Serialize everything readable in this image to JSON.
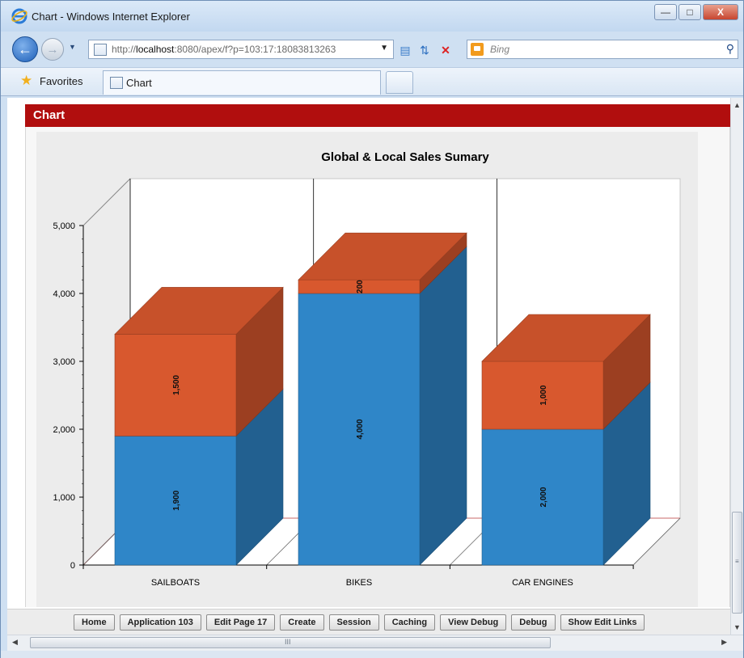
{
  "window": {
    "title": "Chart - Windows Internet Explorer",
    "minimize_icon": "minimize-icon",
    "maximize_icon": "maximize-icon",
    "close_label": "X"
  },
  "nav": {
    "back_icon": "back-arrow-icon",
    "forward_icon": "forward-arrow-icon",
    "address_prefix": "http://",
    "address_host": "localhost",
    "address_rest": ":8080/apex/f?p=103:17:18083813263",
    "search_placeholder": "Bing"
  },
  "favorites": {
    "label": "Favorites",
    "tab_label": "Chart"
  },
  "region": {
    "title": "Chart"
  },
  "chart_data": {
    "type": "bar",
    "stacked": true,
    "three_d": true,
    "title": "Global & Local Sales Sumary",
    "categories": [
      "SAILBOATS",
      "BIKES",
      "CAR ENGINES"
    ],
    "series": [
      {
        "values": [
          1900,
          4000,
          2000
        ],
        "color": "#2f86c8"
      },
      {
        "values": [
          1500,
          200,
          1000
        ],
        "color": "#d8582e"
      }
    ],
    "ylim": [
      0,
      5000
    ],
    "yticks": [
      "0",
      "1,000",
      "2,000",
      "3,000",
      "4,000",
      "5,000"
    ],
    "data_labels": [
      [
        "1,900",
        "4,000",
        "2,000"
      ],
      [
        "1,500",
        "200",
        "1,000"
      ]
    ],
    "grid": false,
    "legend": "none"
  },
  "devbar": {
    "buttons": [
      "Home",
      "Application 103",
      "Edit Page 17",
      "Create",
      "Session",
      "Caching",
      "View Debug",
      "Debug",
      "Show Edit Links"
    ]
  },
  "scroll": {
    "grip": "III"
  }
}
